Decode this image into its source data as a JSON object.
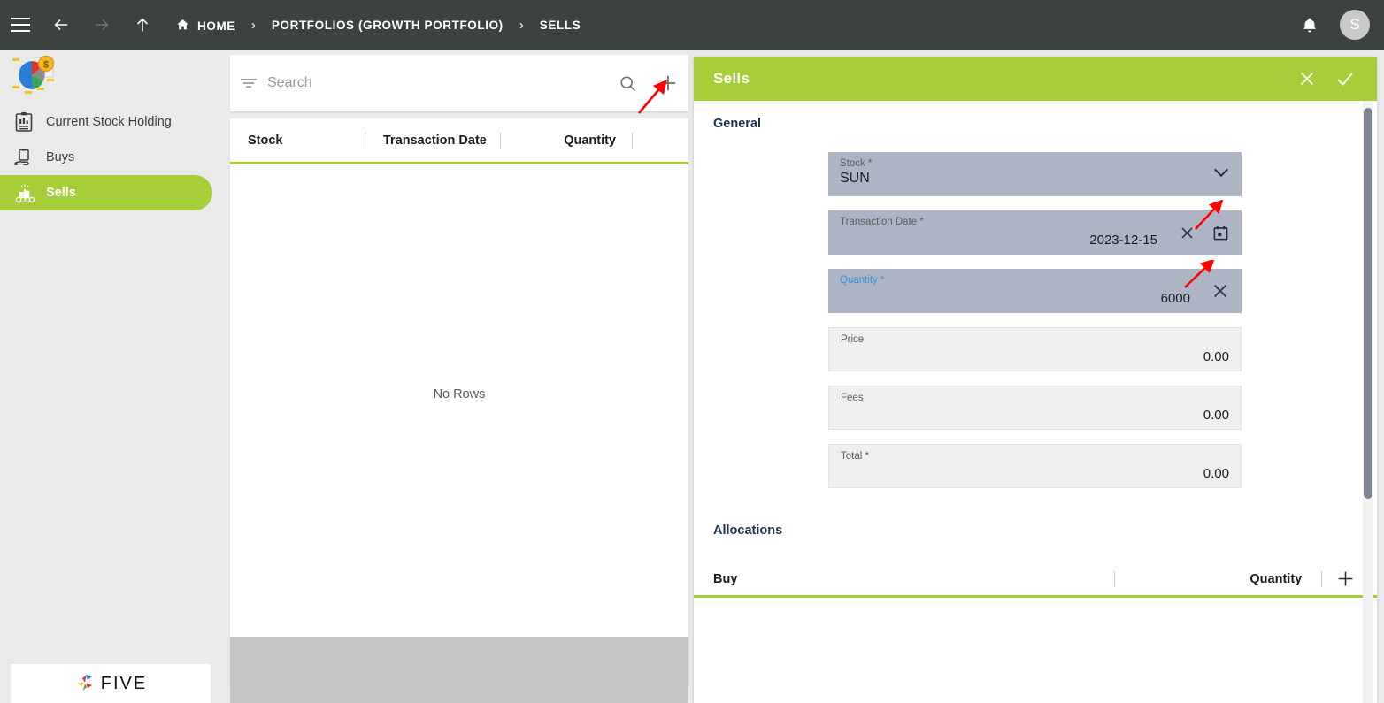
{
  "topbar": {
    "menu_icon": "hamburger-icon",
    "back_icon": "arrow-left-icon",
    "forward_icon": "arrow-right-icon",
    "up_icon": "arrow-up-icon",
    "home_icon": "home-icon",
    "notifications_icon": "bell-icon",
    "breadcrumbs": [
      {
        "label": "HOME"
      },
      {
        "label": "PORTFOLIOS (GROWTH PORTFOLIO)"
      },
      {
        "label": "SELLS"
      }
    ],
    "separator": "›",
    "avatar_initial": "S",
    "background_color": "#3b423f"
  },
  "sidebar": {
    "logo_name": "portfolio-pie-logo",
    "items": [
      {
        "label": "Current Stock Holding",
        "icon": "clipboard-report-icon",
        "active": false
      },
      {
        "label": "Buys",
        "icon": "hand-clipboard-icon",
        "active": false
      },
      {
        "label": "Sells",
        "icon": "money-stack-icon",
        "active": true
      }
    ],
    "footer_logo_text": "FIVE",
    "active_color": "#a5ce39"
  },
  "list_panel": {
    "search": {
      "placeholder": "Search",
      "value": "",
      "filter_icon": "filter-icon",
      "search_icon": "search-icon",
      "add_icon": "plus-icon"
    },
    "grid": {
      "columns": [
        "Stock",
        "Transaction Date",
        "Quantity"
      ],
      "rows": [],
      "empty_message": "No Rows"
    }
  },
  "form_panel": {
    "title": "Sells",
    "close_icon": "close-icon",
    "confirm_icon": "check-icon",
    "header_color": "#a5ce39",
    "section_general": "General",
    "fields": [
      {
        "label": "Stock *",
        "value": "SUN",
        "align": "left",
        "state": "highlighted",
        "icon": "chevron-down-icon"
      },
      {
        "label": "Transaction Date *",
        "value": "2023-12-15",
        "align": "right",
        "state": "highlighted",
        "icon": "calendar-icon",
        "clear_icon": "close-icon"
      },
      {
        "label": "Quantity *",
        "value": "6000",
        "align": "right",
        "state": "focused",
        "clear_icon": "close-icon"
      },
      {
        "label": "Price",
        "value": "0.00",
        "align": "right",
        "state": "normal"
      },
      {
        "label": "Fees",
        "value": "0.00",
        "align": "right",
        "state": "normal"
      },
      {
        "label": "Total *",
        "value": "0.00",
        "align": "right",
        "state": "normal"
      }
    ],
    "section_allocations": "Allocations",
    "allocations": {
      "columns": [
        "Buy",
        "Quantity"
      ],
      "add_icon": "plus-icon",
      "rows": []
    }
  }
}
